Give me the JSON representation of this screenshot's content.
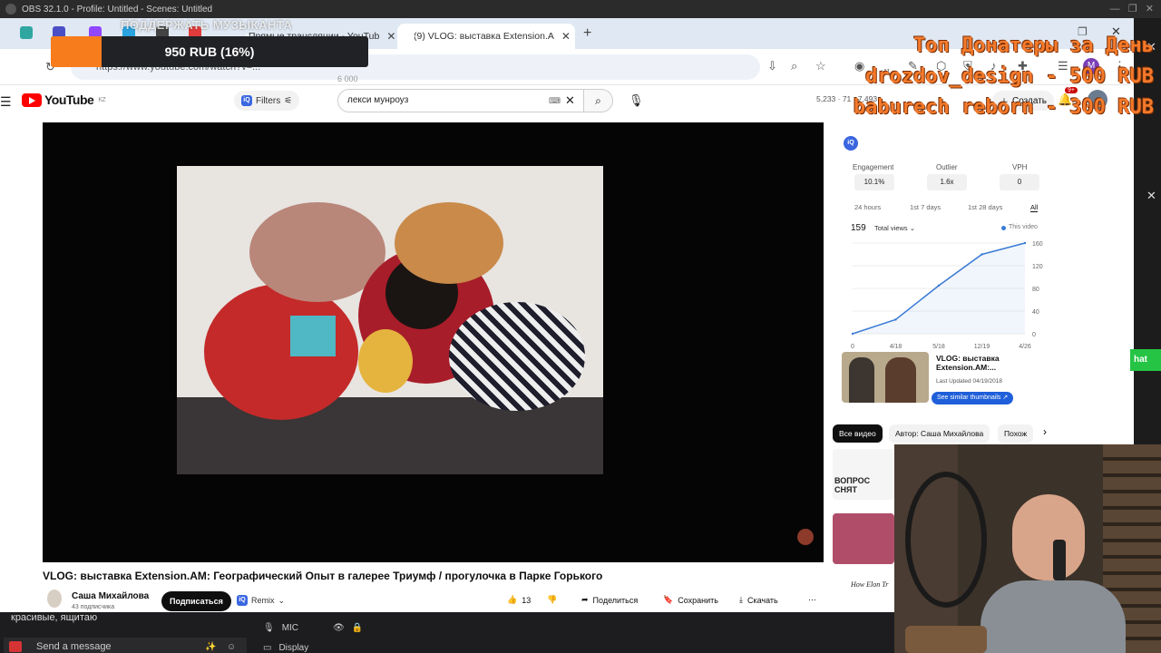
{
  "obs": {
    "title": "OBS 32.1.0 - Profile: Untitled - Scenes: Untitled",
    "chat_last_line": "красивые, ящитаю",
    "chat_placeholder": "Send a message",
    "mixer": [
      {
        "label": "MIC"
      },
      {
        "label": "Display"
      }
    ]
  },
  "donation_goal": {
    "title": "ПОДДЕРЖАТЬ МУЗЫКАНТА",
    "amount_text": "950 RUB (16%)",
    "progress": 0.16,
    "fill_color": "#f77c1c"
  },
  "top_donators": {
    "title": "Топ Донатеры за День",
    "entries": [
      "drozdov_design - 500 RUB",
      "baburech reborn - 300 RUB"
    ],
    "color": "#f47a2b"
  },
  "browser": {
    "tabs": [
      {
        "label": "Прямые трансляции - YouTub",
        "active": false
      },
      {
        "label": "(9) VLOG: выставка Extension.A",
        "active": true
      }
    ],
    "url": "https://www.youtube.com/watch?v=...",
    "omnibox_hint": "6 000",
    "profile_initial": "M",
    "extensions_badge": "+11"
  },
  "youtube": {
    "logo_text": "YouTube",
    "logo_sup": "KZ",
    "filters_label": "Filters",
    "search_value": "лекси мунроуз",
    "header_stats": "5,233 · 71 · 7,493",
    "create_label": "Создать",
    "notif_badge": "9+",
    "video": {
      "title": "VLOG: выставка Extension.AM: Географический Опыт в галерее Триумф / прогулочка в Парке Горького",
      "channel": "Саша Михайлова",
      "subscribers": "43 подписчика",
      "subscribe_label": "Подписаться",
      "remix_label": "Remix",
      "likes": "13",
      "share_label": "Поделиться",
      "save_label": "Сохранить",
      "download_label": "Скачать"
    }
  },
  "vidiq": {
    "metrics": [
      {
        "label": "Engagement",
        "value": "10.1%"
      },
      {
        "label": "Outlier",
        "value": "1.6x"
      },
      {
        "label": "VPH",
        "value": "0"
      }
    ],
    "periods": [
      "24 hours",
      "1st 7 days",
      "1st 28 days",
      "All"
    ],
    "active_period": "All",
    "total_views": "159",
    "views_selector": "Total views",
    "legend": "This video",
    "similar": {
      "title": "VLOG: выставка Extension.AM:...",
      "updated": "Last Updated 04/19/2018",
      "button": "See similar thumbnails ↗"
    }
  },
  "chart_data": {
    "type": "line",
    "x": [
      "0",
      "4/18",
      "5/18",
      "12/19",
      "4/26"
    ],
    "series": [
      {
        "values": [
          0,
          25,
          85,
          140,
          160
        ]
      }
    ],
    "yticks": [
      0,
      40,
      80,
      120,
      160
    ],
    "ylim": [
      0,
      160
    ],
    "line_color": "#3a7bd5"
  },
  "recommendations": {
    "chips": [
      "Все видео",
      "Автор: Саша Михайлова",
      "Похож"
    ],
    "thumb_texts": [
      "ВОПРОС СНЯТ",
      "How Elon Tr"
    ]
  },
  "green_button": "hat"
}
